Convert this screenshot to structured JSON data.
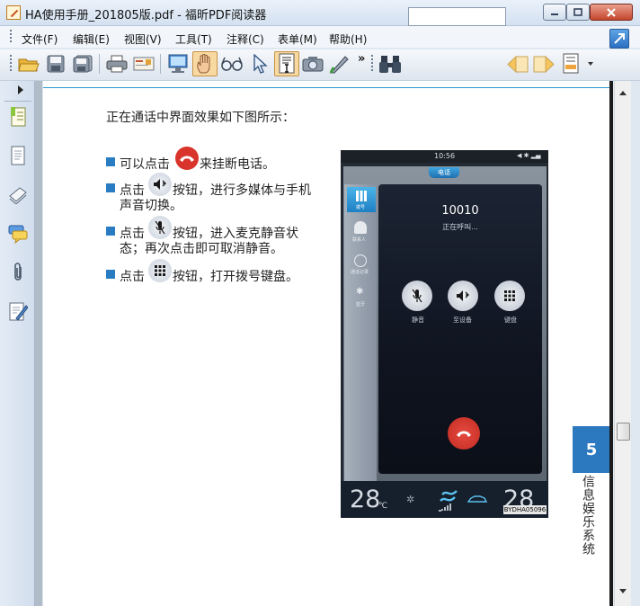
{
  "window": {
    "title": "HA使用手册_201805版.pdf - 福昕PDF阅读器",
    "controls": [
      "minimize",
      "maximize",
      "close"
    ]
  },
  "menu": {
    "items": [
      "文件(F)",
      "编辑(E)",
      "视图(V)",
      "工具(T)",
      "注释(C)",
      "表单(M)",
      "帮助(H)"
    ]
  },
  "toolbar": {
    "tools": [
      "open-icon",
      "save-icon",
      "save-all-icon",
      "print-icon",
      "email-icon",
      "fullscreen-icon",
      "hand-tool-icon",
      "zoom-glasses-icon",
      "select-cursor-icon",
      "text-select-icon",
      "snapshot-camera-icon",
      "typewriter-icon",
      "find-binoculars-icon",
      "prev-result-icon",
      "next-result-icon",
      "highlight-menu-icon"
    ],
    "search_value": "",
    "overflow": "»"
  },
  "left_panel": {
    "icons": [
      "bookmarks-icon",
      "pages-icon",
      "layers-icon",
      "comments-icon",
      "attachments-icon",
      "signature-icon"
    ]
  },
  "page": {
    "intro": "正在通话中界面效果如下图所示：",
    "bullets": [
      {
        "before": "可以点击",
        "icon": "hangup-icon",
        "after": "来挂断电话。",
        "line2": ""
      },
      {
        "before": "点击",
        "icon": "speaker-bluetooth-icon",
        "after": "按钮，进行多媒体与手机",
        "line2": "声音切换。"
      },
      {
        "before": "点击",
        "icon": "mute-mic-icon",
        "after": "按钮，进入麦克静音状",
        "line2": "态；再次点击即可取消静音。"
      },
      {
        "before": "点击",
        "icon": "keypad-icon",
        "after": "按钮，打开拨号键盘。",
        "line2": ""
      }
    ],
    "chapter_number": "5",
    "chapter_title": "信息娱乐系统"
  },
  "phone": {
    "time": "10:56",
    "tab": "电话",
    "sidebar": [
      "拨号",
      "联系人",
      "通话记录",
      "蓝牙"
    ],
    "number": "10010",
    "status": "正在呼叫...",
    "buttons": [
      "静音",
      "至设备",
      "键盘"
    ],
    "temp_left": "28",
    "temp_unit": "℃",
    "temp_right": "28",
    "code": "BYDHA05096"
  },
  "colors": {
    "accent_blue": "#2c79c0",
    "hangup_red": "#d9342b",
    "active_tool": "#f9d9a2"
  }
}
